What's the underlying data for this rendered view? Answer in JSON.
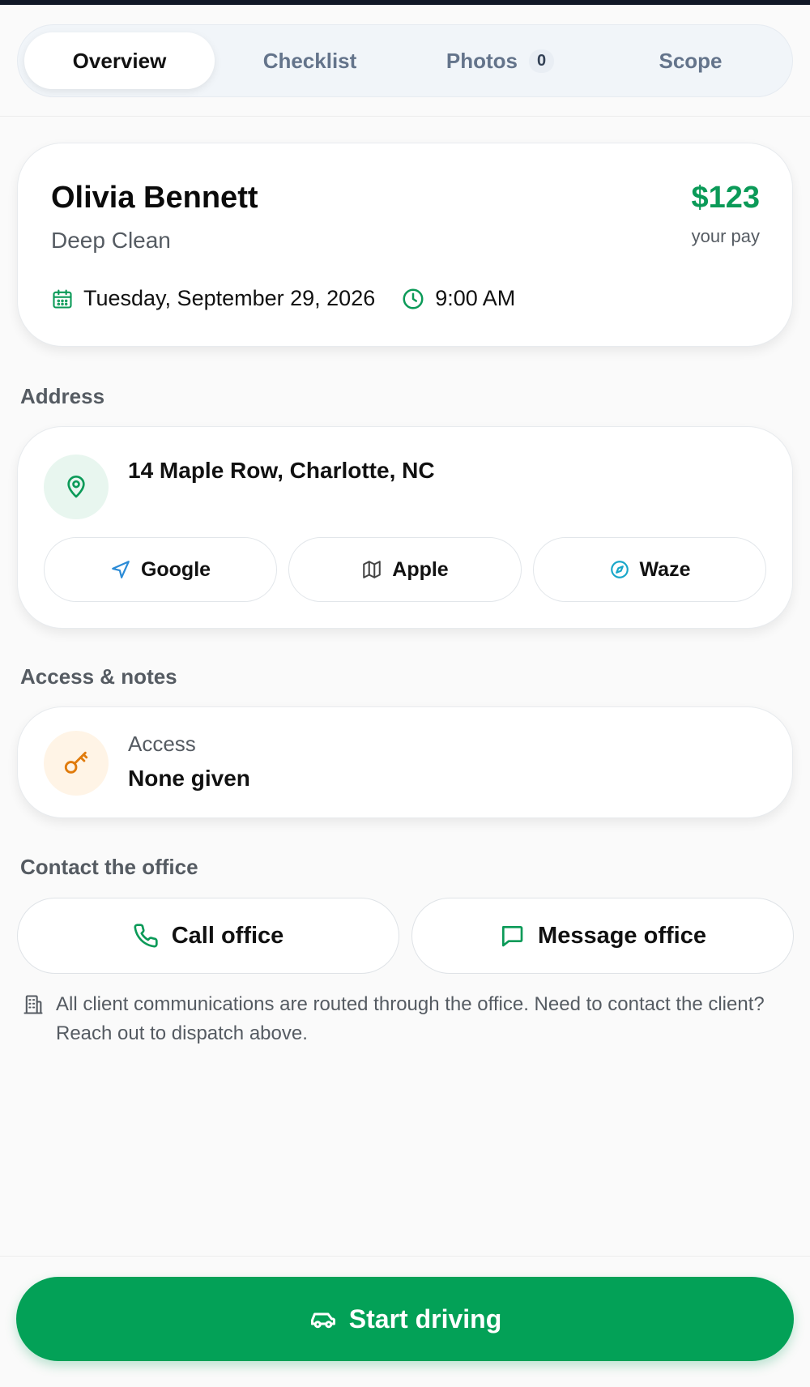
{
  "tabs": [
    {
      "label": "Overview",
      "active": true
    },
    {
      "label": "Checklist",
      "active": false
    },
    {
      "label": "Photos",
      "active": false,
      "badge": "0"
    },
    {
      "label": "Scope",
      "active": false
    }
  ],
  "job": {
    "client_name": "Olivia Bennett",
    "service": "Deep Clean",
    "pay_amount": "$123",
    "pay_label": "your pay",
    "date": "Tuesday, September 29, 2026",
    "time": "9:00 AM"
  },
  "address": {
    "section_label": "Address",
    "text": "14 Maple Row, Charlotte, NC",
    "map_buttons": [
      {
        "label": "Google",
        "icon": "navigation-arrow-icon"
      },
      {
        "label": "Apple",
        "icon": "map-icon"
      },
      {
        "label": "Waze",
        "icon": "compass-icon"
      }
    ]
  },
  "access_notes": {
    "section_label": "Access & notes",
    "access_label": "Access",
    "access_value": "None given"
  },
  "contact": {
    "section_label": "Contact the office",
    "call_label": "Call office",
    "message_label": "Message office",
    "note": "All client communications are routed through the office. Need to contact the client? Reach out to dispatch above."
  },
  "footer": {
    "start_label": "Start driving"
  },
  "colors": {
    "primary_green": "#03a157",
    "pay_green": "#0b9a58",
    "key_orange": "#e07b0c",
    "waze_blue": "#19a7c9",
    "nav_blue": "#2b8bd6"
  }
}
